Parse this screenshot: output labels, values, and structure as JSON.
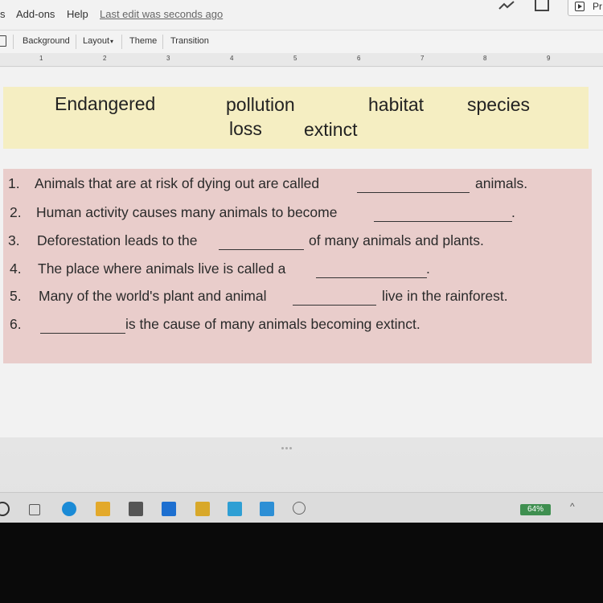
{
  "menubar": {
    "partial_menu": "s",
    "addons": "Add-ons",
    "help": "Help",
    "last_edit": "Last edit was seconds ago",
    "present_partial": "Pr"
  },
  "toolbar": {
    "background": "Background",
    "layout": "Layout",
    "theme": "Theme",
    "transition": "Transition"
  },
  "ruler": {
    "numbers": [
      "1",
      "2",
      "3",
      "4",
      "5",
      "6",
      "7",
      "8",
      "9"
    ]
  },
  "word_bank": {
    "words": [
      "Endangered",
      "pollution",
      "loss",
      "extinct",
      "habitat",
      "species"
    ]
  },
  "sentences": [
    {
      "num": "1.",
      "before": "Animals that are at risk of dying out are called",
      "after": "animals."
    },
    {
      "num": "2.",
      "before": "Human activity causes many animals to become",
      "after": "."
    },
    {
      "num": "3.",
      "before": "Deforestation leads to the",
      "after": "of many animals and plants."
    },
    {
      "num": "4.",
      "before": "The place where animals live is called a",
      "after": "."
    },
    {
      "num": "5.",
      "before": "Many of the world's plant and animal",
      "after": "live in the rainforest."
    },
    {
      "num": "6.",
      "before": "",
      "after": "is the cause of many animals becoming extinct."
    }
  ],
  "taskbar": {
    "battery": "64%"
  },
  "colors": {
    "word_bank_bg": "#f5eec2",
    "sentences_bg": "#e9cdcb"
  }
}
